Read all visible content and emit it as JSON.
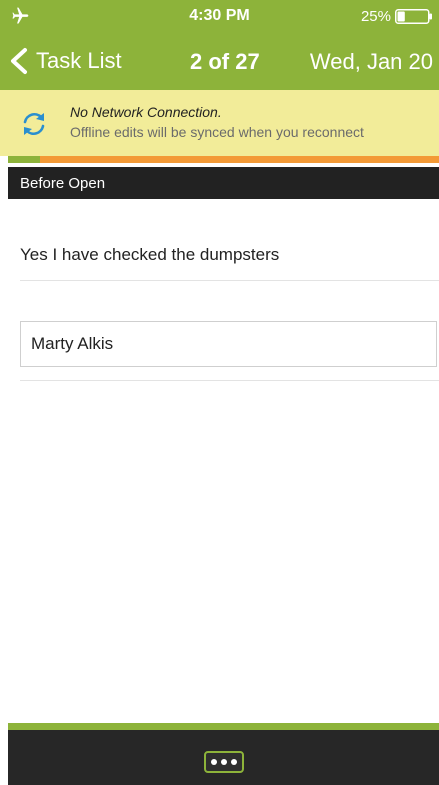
{
  "status_bar": {
    "time": "4:30 PM",
    "battery_text": "25%",
    "battery_level": 0.25,
    "icons": [
      "airplane-icon",
      "battery-icon"
    ]
  },
  "nav": {
    "back_label": "Task List",
    "counter": "2 of 27",
    "date": "Wed, Jan 20",
    "icons": [
      "chevron-left-icon"
    ]
  },
  "banner": {
    "title": "No Network Connection.",
    "message": "Offline edits will be synced when you reconnect",
    "icon": "sync-icon"
  },
  "progress": {
    "current": 2,
    "total": 27
  },
  "section": {
    "title": "Before Open"
  },
  "form": {
    "answer_text": "Yes I have checked the dumpsters",
    "name_value": "Marty Alkis"
  },
  "toolbar": {
    "more_icon": "more-dots-icon"
  },
  "colors": {
    "accent_green": "#8db33a",
    "banner_yellow": "#f2ec99",
    "progress_orange": "#f39a36",
    "dark": "#222222",
    "toolbar_dark": "#272727"
  }
}
